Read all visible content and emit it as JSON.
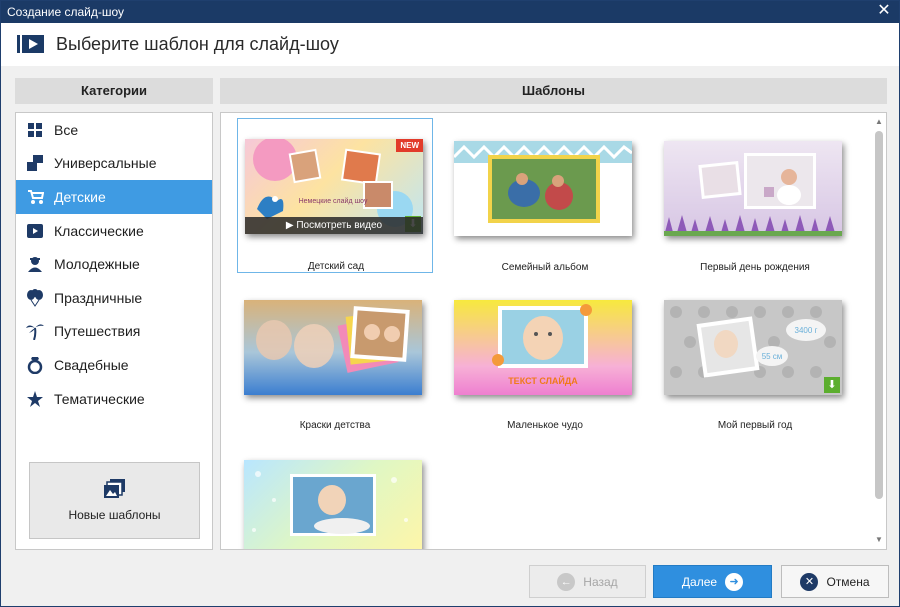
{
  "window": {
    "title": "Создание слайд-шоу",
    "close_glyph": "✕"
  },
  "header": {
    "heading": "Выберите шаблон для слайд-шоу",
    "icon": "slideshow-icon"
  },
  "categories_panel": {
    "title": "Категории",
    "items": [
      {
        "label": "Все",
        "icon": "grid-icon"
      },
      {
        "label": "Универсальные",
        "icon": "stack-icon"
      },
      {
        "label": "Детские",
        "icon": "stroller-icon"
      },
      {
        "label": "Классические",
        "icon": "film-icon"
      },
      {
        "label": "Молодежные",
        "icon": "person-icon"
      },
      {
        "label": "Праздничные",
        "icon": "balloons-icon"
      },
      {
        "label": "Путешествия",
        "icon": "palm-icon"
      },
      {
        "label": "Свадебные",
        "icon": "ring-icon"
      },
      {
        "label": "Тематические",
        "icon": "star-icon"
      }
    ],
    "active_index": 2,
    "new_templates_label": "Новые шаблоны"
  },
  "templates_panel": {
    "title": "Шаблоны",
    "items": [
      {
        "label": "Детский сад",
        "badge": "NEW",
        "preview": "Посмотреть видео",
        "downloadable": true,
        "selected": true,
        "thumb_text": "Немецкие слайд шоу"
      },
      {
        "label": "Семейный альбом"
      },
      {
        "label": "Первый день рождения"
      },
      {
        "label": "Краски детства"
      },
      {
        "label": "Маленькое чудо",
        "thumb_text": "ТЕКСТ СЛАЙДА"
      },
      {
        "label": "Мой первый год",
        "downloadable": true,
        "thumb_text_1": "3400 г",
        "thumb_text_2": "55 см"
      },
      {
        "label": ""
      }
    ]
  },
  "footer": {
    "back_label": "Назад",
    "next_label": "Далее",
    "cancel_label": "Отмена"
  },
  "colors": {
    "accent": "#3f9be3",
    "titlebar": "#1b3a66",
    "primary_button": "#2f8fdf"
  }
}
